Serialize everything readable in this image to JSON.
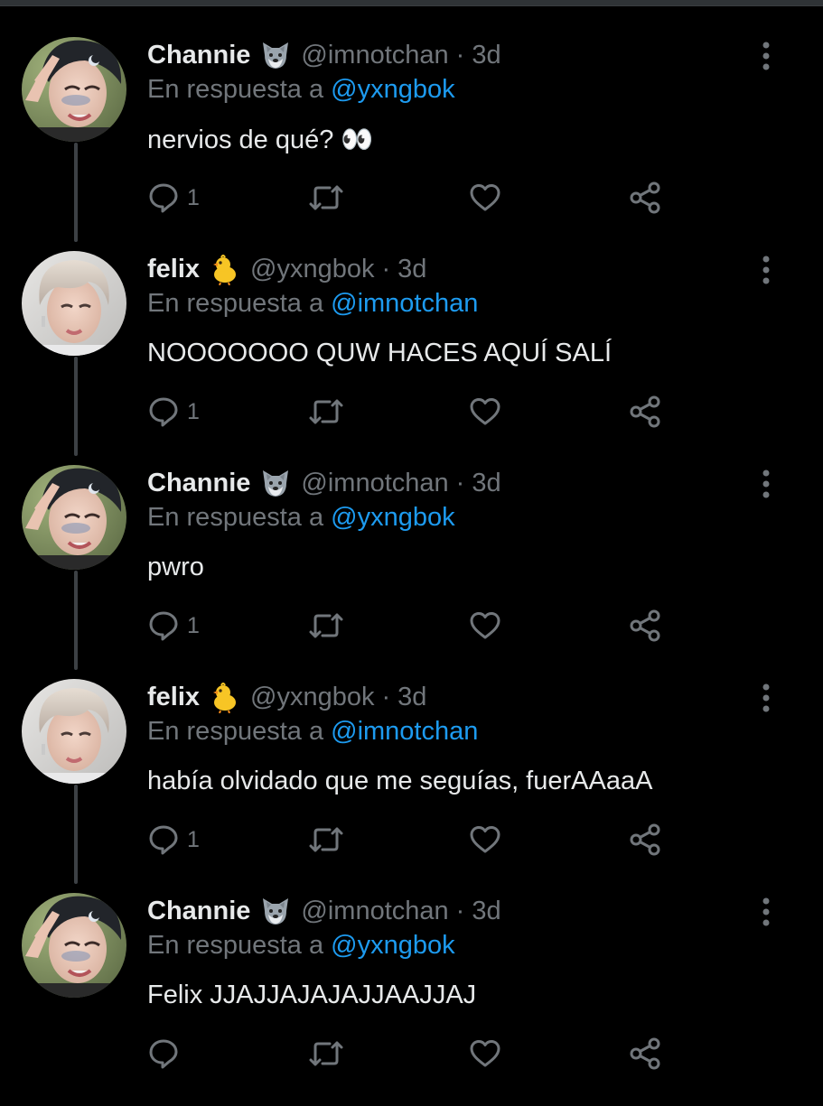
{
  "colors": {
    "background": "#000000",
    "text": "#e7e9ea",
    "secondary": "#71767b",
    "mention": "#1d9bf0",
    "thread_line": "#3d4145"
  },
  "reply_prefix": "En respuesta a",
  "tweets": [
    {
      "name": "Channie",
      "badge_icon": "wolf-emoji",
      "handle": "@imnotchan",
      "separator": "·",
      "time": "3d",
      "reply_to": "@yxngbok",
      "text": "nervios de qué? 👀",
      "reply_count": "1"
    },
    {
      "name": "felix",
      "badge_icon": "baby-chick-emoji",
      "handle": "@yxngbok",
      "separator": "·",
      "time": "3d",
      "reply_to": "@imnotchan",
      "text": "NOOOOOOO QUW HACES AQUÍ SALÍ",
      "reply_count": "1"
    },
    {
      "name": "Channie",
      "badge_icon": "wolf-emoji",
      "handle": "@imnotchan",
      "separator": "·",
      "time": "3d",
      "reply_to": "@yxngbok",
      "text": "pwro",
      "reply_count": "1"
    },
    {
      "name": "felix",
      "badge_icon": "baby-chick-emoji",
      "handle": "@yxngbok",
      "separator": "·",
      "time": "3d",
      "reply_to": "@imnotchan",
      "text": "había olvidado que me seguías, fuerAAaaA",
      "reply_count": "1"
    },
    {
      "name": "Channie",
      "badge_icon": "wolf-emoji",
      "handle": "@imnotchan",
      "separator": "·",
      "time": "3d",
      "reply_to": "@yxngbok",
      "text": "Felix JJAJJAJAJAJJAAJJAJ",
      "reply_count": ""
    }
  ]
}
